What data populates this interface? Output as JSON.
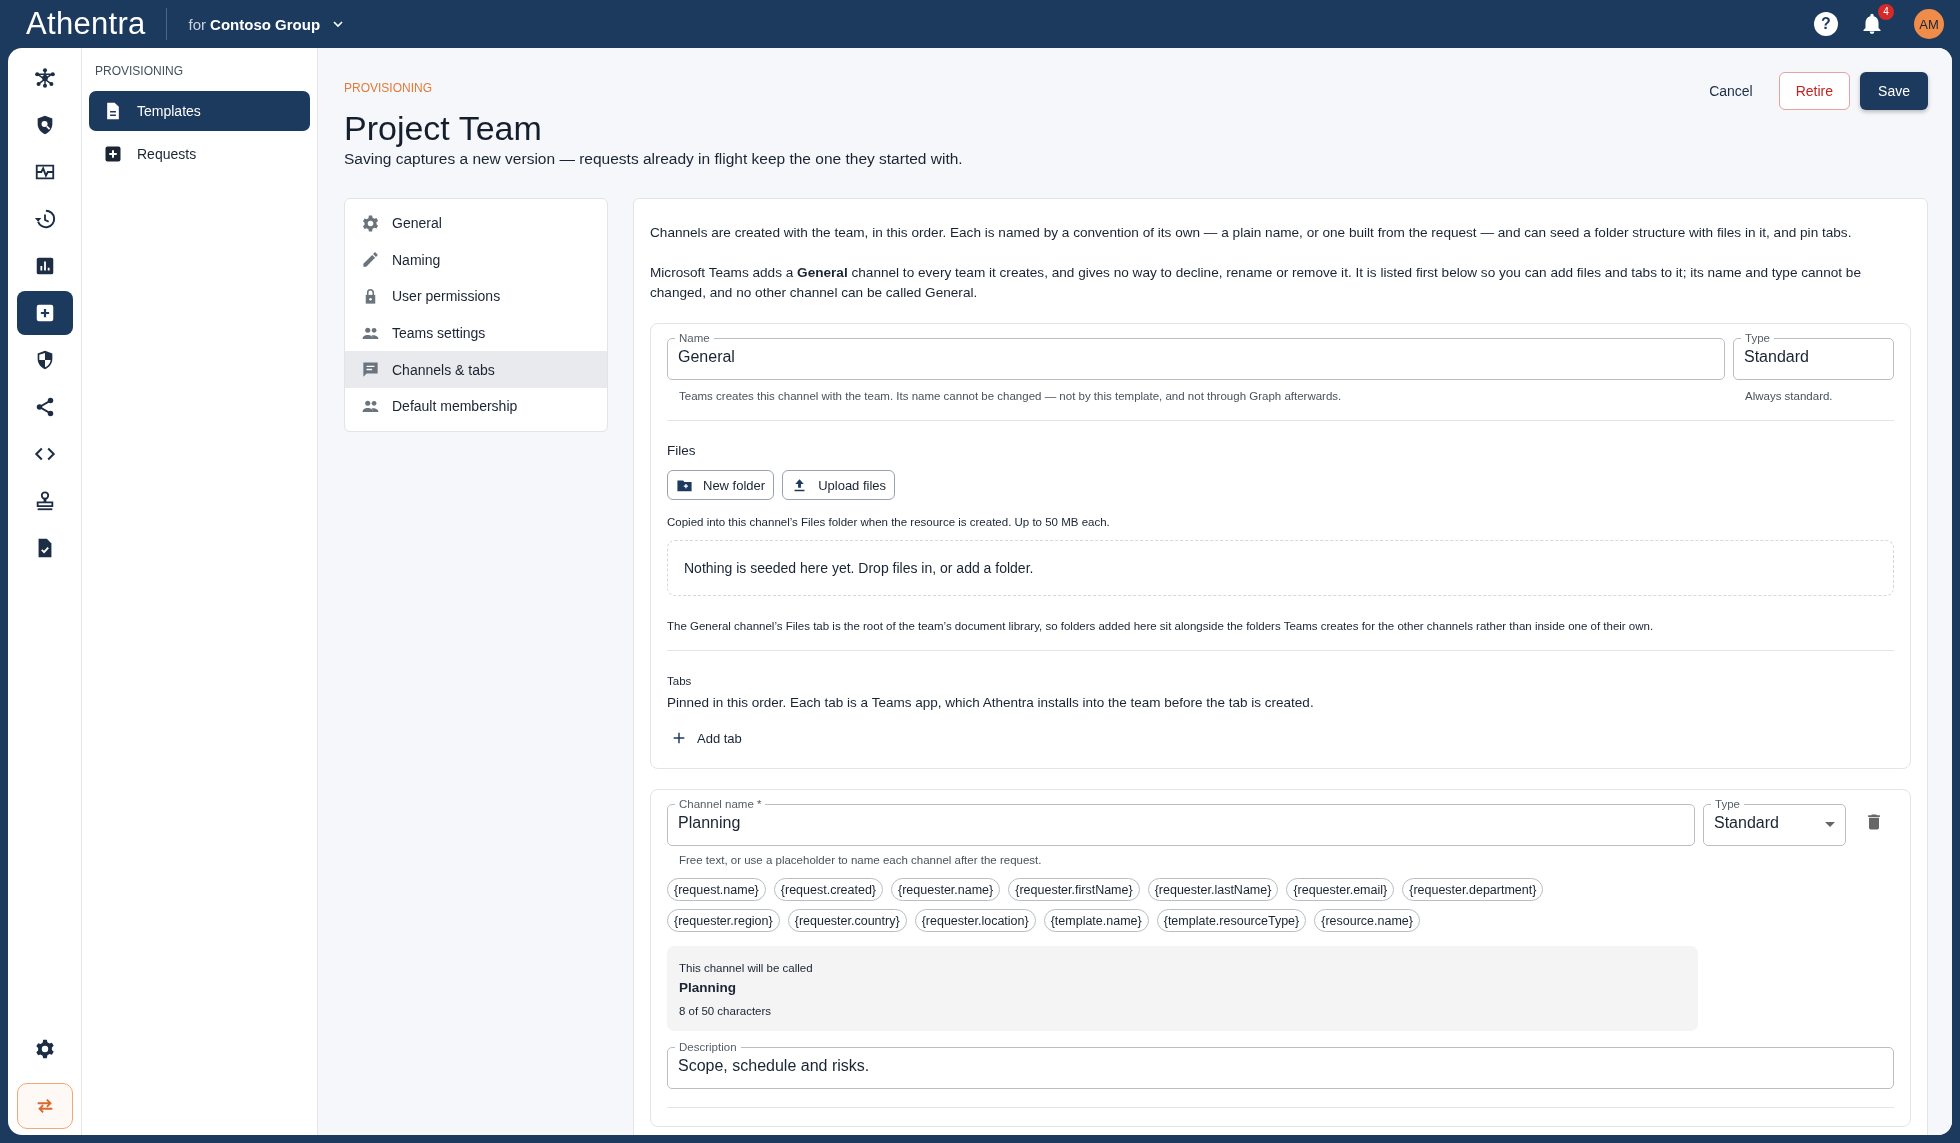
{
  "app": {
    "help": "?",
    "logo": "Athentra",
    "org_prefix": "for",
    "org": "Contoso Group",
    "notification_count": "4",
    "avatar": "AM"
  },
  "rail": {
    "items": [
      {
        "selected": false
      },
      {
        "selected": false
      },
      {
        "selected": false
      },
      {
        "selected": false
      },
      {
        "selected": false
      },
      {
        "selected": true
      },
      {
        "selected": false
      },
      {
        "selected": false
      },
      {
        "selected": false
      },
      {
        "selected": false
      },
      {
        "selected": false
      }
    ]
  },
  "sidebar": {
    "heading": "PROVISIONING",
    "items": [
      {
        "label": "Templates",
        "selected": true
      },
      {
        "label": "Requests",
        "selected": false
      }
    ]
  },
  "page": {
    "breadcrumb": "PROVISIONING",
    "title": "Project Team",
    "subtitle": "Saving captures a new version — requests already in flight keep the one they started with.",
    "actions": [
      {
        "label": "Cancel",
        "kind": "text"
      },
      {
        "label": "Retire",
        "kind": "danger"
      },
      {
        "label": "Save",
        "kind": "primary"
      }
    ]
  },
  "sections": [
    {
      "label": "General",
      "selected": false
    },
    {
      "label": "Naming",
      "selected": false
    },
    {
      "label": "User permissions",
      "selected": false
    },
    {
      "label": "Teams settings",
      "selected": false
    },
    {
      "label": "Channels & tabs",
      "selected": true
    },
    {
      "label": "Default membership",
      "selected": false
    }
  ],
  "intro": [
    "Channels are created with the team, in this order. Each is named by a convention of its own — a plain name, or one built from the request — and can seed a folder structure with files in it, and pin tabs.",
    "Microsoft Teams adds a **General** channel to every team it creates, and gives no way to decline, rename or remove it. It is listed first below so you can add files and tabs to it; its name and type cannot be changed, and no other channel can be called General."
  ],
  "general_channel": {
    "name_label": "Name",
    "name": "General",
    "type_label": "Type",
    "type": "Standard",
    "name_help": "Teams creates this channel with the team. Its name cannot be changed — not by this template, and not through Graph afterwards.",
    "type_help": "Always standard.",
    "files_heading": "Files",
    "file_buttons": [
      "New folder",
      "Upload files"
    ],
    "files_help": "Copied into this channel’s Files folder when the resource is created. Up to 50 MB each.",
    "empty": "Nothing is seeded here yet. Drop files in, or add a folder.",
    "files_note": "The General channel’s Files tab is the root of the team’s document library, so folders added here sit alongside the folders Teams creates for the other channels rather than inside one of their own.",
    "tabs_heading": "Tabs",
    "tabs_help": "Pinned in this order. Each tab is a Teams app, which Athentra installs into the team before the tab is created.",
    "add_tab": "Add tab"
  },
  "channels": [
    {
      "name_label": "Channel name *",
      "name": "Planning",
      "type_label": "Type",
      "type": "Standard",
      "help": "Free text, or use a placeholder to name each channel after the request.",
      "placeholders": [
        "{request.name}",
        "{request.created}",
        "{requester.name}",
        "{requester.firstName}",
        "{requester.lastName}",
        "{requester.email}",
        "{requester.department}",
        "{requester.region}",
        "{requester.country}",
        "{requester.location}",
        "{template.name}",
        "{template.resourceType}",
        "{resource.name}"
      ],
      "preview_label": "This channel will be called",
      "preview_name": "Planning",
      "preview_count": "8 of 50 characters",
      "description_label": "Description",
      "description": "Scope, schedule and risks."
    }
  ]
}
